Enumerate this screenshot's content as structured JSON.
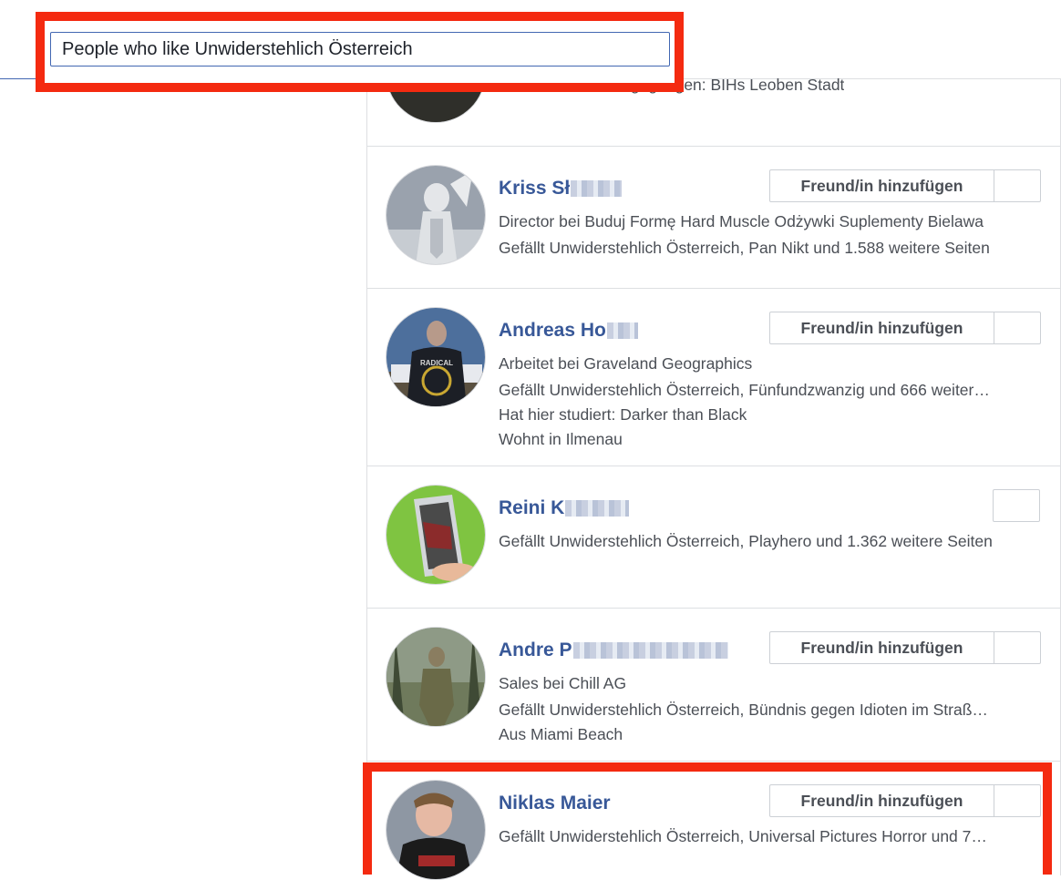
{
  "search": {
    "value": "People who like Unwiderstehlich Österreich"
  },
  "partial_result": {
    "line": "Ist hier zur Schule gegangen: BIHs Leoben Stadt"
  },
  "add_friend_label": "Freund/in hinzufügen",
  "results": [
    {
      "name": "Kriss Sł",
      "lines": [
        "Director bei Buduj Formę Hard Muscle Odżywki Suplementy Bielawa",
        "Gefällt Unwiderstehlich Österreich, Pan Nikt und 1.588 weitere Seiten"
      ]
    },
    {
      "name": "Andreas Ho",
      "lines": [
        "Arbeitet bei Graveland Geographics",
        "Gefällt Unwiderstehlich Österreich, Fünfundzwanzig und 666 weiter…",
        "Hat hier studiert: Darker than Black",
        "Wohnt in Ilmenau"
      ],
      "avatar_text": "RADICAL"
    },
    {
      "name": "Reini K",
      "lines": [
        "Gefällt Unwiderstehlich Österreich, Playhero und 1.362 weitere Seiten"
      ]
    },
    {
      "name": "Andre P",
      "lines": [
        "Sales bei Chill AG",
        "Gefällt Unwiderstehlich Österreich, Bündnis gegen Idioten im Straß…",
        "Aus Miami Beach"
      ]
    },
    {
      "name": "Niklas Maier",
      "lines": [
        "Gefällt Unwiderstehlich Österreich, Universal Pictures Horror und 7…"
      ]
    }
  ],
  "colors": {
    "highlight": "#f42a10",
    "link": "#385898",
    "text": "#4b4f56",
    "accent": "#4267b2"
  }
}
